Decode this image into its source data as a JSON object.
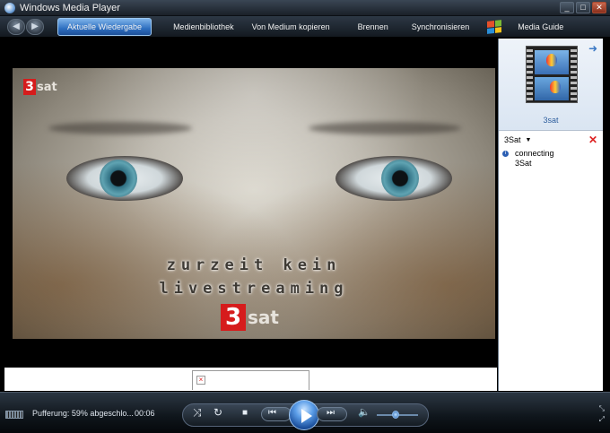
{
  "window": {
    "title": "Windows Media Player"
  },
  "titlebar": {
    "min": "_",
    "max": "□",
    "close": "✕"
  },
  "nav": {
    "back": "◀",
    "forward": "▶",
    "tabs": [
      {
        "label": "Aktuelle Wiedergabe",
        "active": true
      },
      {
        "label": "Medienbibliothek"
      },
      {
        "label": "Von Medium kopieren"
      },
      {
        "label": "Brennen"
      },
      {
        "label": "Synchronisieren"
      },
      {
        "label": "Media Guide"
      }
    ]
  },
  "video": {
    "logo_number": "3",
    "logo_text": "sat",
    "overlay_line1": "zurzeit kein",
    "overlay_line2": "livestreaming"
  },
  "info_strip": {
    "broken_image": "×"
  },
  "panel": {
    "arrow": "➜",
    "thumb_label": "3sat",
    "playlist_name": "3Sat",
    "caret": "▼",
    "remove": "✕",
    "entry_status": "connecting",
    "entry_name": "3Sat",
    "info_glyph": "i"
  },
  "controls": {
    "status": "Pufferung: 59% abgeschlo...",
    "time": "00:06",
    "shuffle": "⤨",
    "repeat": "↻",
    "stop": "■",
    "prev": "⏮",
    "next": "⏭",
    "volume": "🔈",
    "volume_level": 0.45,
    "corner_top": "⤡",
    "corner_bottom": "⤢"
  },
  "colors": {
    "accent": "#2e6fc0",
    "brand_red": "#d61c1c"
  }
}
